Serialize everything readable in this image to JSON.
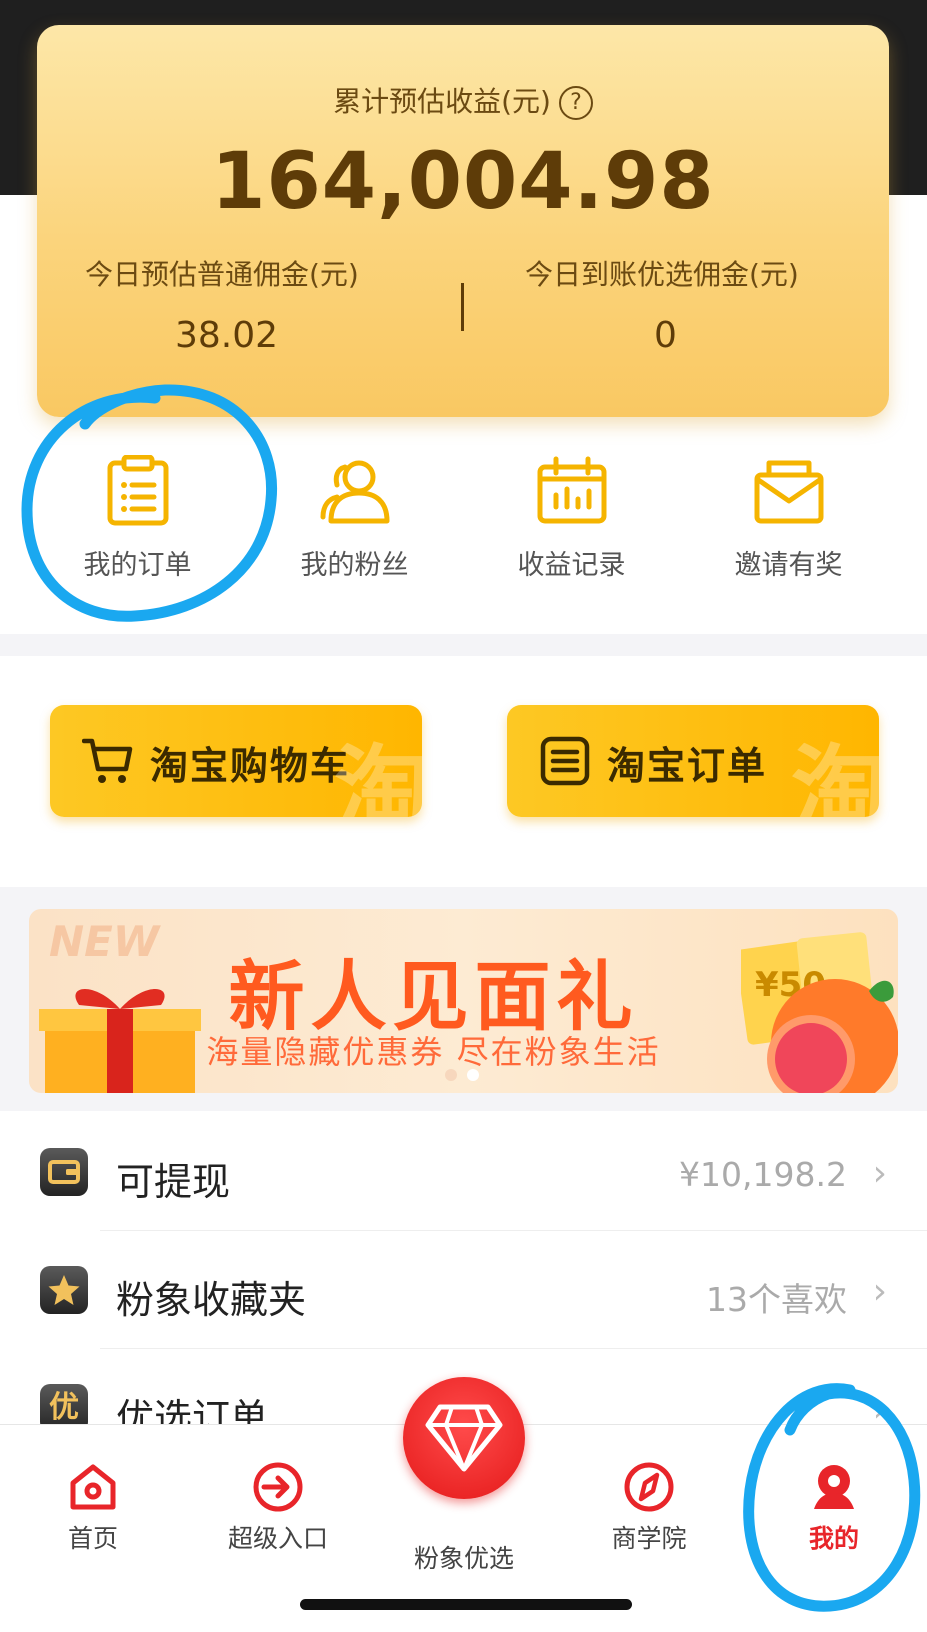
{
  "earnings": {
    "title": "累计预估收益(元)",
    "help_glyph": "?",
    "total": "164,004.98",
    "left_label": "今日预估普通佣金(元)",
    "left_value": "38.02",
    "right_label": "今日到账优选佣金(元)",
    "right_value": "0"
  },
  "quick_actions": [
    {
      "label": "我的订单",
      "icon": "clipboard-icon"
    },
    {
      "label": "我的粉丝",
      "icon": "fans-icon"
    },
    {
      "label": "收益记录",
      "icon": "calendar-chart-icon"
    },
    {
      "label": "邀请有奖",
      "icon": "envelope-icon"
    }
  ],
  "taobao_buttons": [
    {
      "label": "淘宝购物车",
      "icon": "cart-icon",
      "watermark": "淘"
    },
    {
      "label": "淘宝订单",
      "icon": "list-icon",
      "watermark": "淘"
    }
  ],
  "banner": {
    "badge": "NEW",
    "title": "新人见面礼",
    "subtitle": "海量隐藏优惠券 尽在粉象生活",
    "coupon_text": "¥50"
  },
  "list": [
    {
      "label": "可提现",
      "value": "¥10,198.2",
      "icon": "wallet-icon"
    },
    {
      "label": "粉象收藏夹",
      "value": "13个喜欢",
      "icon": "star-icon"
    },
    {
      "label": "优选订单",
      "value": "",
      "icon": "you-icon",
      "icon_text": "优"
    }
  ],
  "tabbar": [
    {
      "label": "首页",
      "icon": "home-icon"
    },
    {
      "label": "超级入口",
      "icon": "enter-icon"
    },
    {
      "label": "粉象优选",
      "icon": "diamond-icon"
    },
    {
      "label": "商学院",
      "icon": "compass-icon"
    },
    {
      "label": "我的",
      "icon": "profile-icon"
    }
  ],
  "colors": {
    "accent_red": "#e8252a",
    "gold_dark": "#5e3c08",
    "quick_icon": "#f5b400",
    "annotation_blue": "#1aa8f0"
  }
}
